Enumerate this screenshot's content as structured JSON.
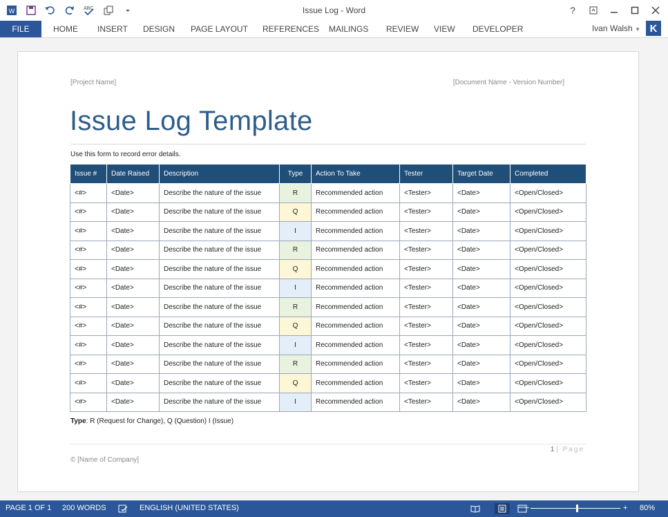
{
  "window": {
    "title": "Issue Log - Word",
    "help": "?",
    "user_name": "Ivan Walsh",
    "user_initial": "K"
  },
  "ribbon": {
    "file": "FILE",
    "tabs": [
      "HOME",
      "INSERT",
      "DESIGN",
      "PAGE LAYOUT",
      "REFERENCES",
      "MAILINGS",
      "REVIEW",
      "VIEW",
      "DEVELOPER"
    ]
  },
  "document": {
    "header_left": "[Project Name]",
    "header_right": "[Document Name - Version Number]",
    "title": "Issue Log Template",
    "intro": "Use this form to record error details.",
    "table": {
      "columns": [
        "Issue #",
        "Date Raised",
        "Description",
        "Type",
        "Action To Take",
        "Tester",
        "Target Date",
        "Completed"
      ],
      "rows": [
        [
          "<#>",
          "<Date>",
          "Describe the nature of the issue",
          "R",
          "Recommended action",
          "<Tester>",
          "<Date>",
          "<Open/Closed>"
        ],
        [
          "<#>",
          "<Date>",
          "Describe the nature of the issue",
          "Q",
          "Recommended action",
          "<Tester>",
          "<Date>",
          "<Open/Closed>"
        ],
        [
          "<#>",
          "<Date>",
          "Describe the nature of the issue",
          "I",
          "Recommended action",
          "<Tester>",
          "<Date>",
          "<Open/Closed>"
        ],
        [
          "<#>",
          "<Date>",
          "Describe the nature of the issue",
          "R",
          "Recommended action",
          "<Tester>",
          "<Date>",
          "<Open/Closed>"
        ],
        [
          "<#>",
          "<Date>",
          "Describe the nature of the issue",
          "Q",
          "Recommended action",
          "<Tester>",
          "<Date>",
          "<Open/Closed>"
        ],
        [
          "<#>",
          "<Date>",
          "Describe the nature of the issue",
          "I",
          "Recommended action",
          "<Tester>",
          "<Date>",
          "<Open/Closed>"
        ],
        [
          "<#>",
          "<Date>",
          "Describe the nature of the issue",
          "R",
          "Recommended action",
          "<Tester>",
          "<Date>",
          "<Open/Closed>"
        ],
        [
          "<#>",
          "<Date>",
          "Describe the nature of the issue",
          "Q",
          "Recommended action",
          "<Tester>",
          "<Date>",
          "<Open/Closed>"
        ],
        [
          "<#>",
          "<Date>",
          "Describe the nature of the issue",
          "I",
          "Recommended action",
          "<Tester>",
          "<Date>",
          "<Open/Closed>"
        ],
        [
          "<#>",
          "<Date>",
          "Describe the nature of the issue",
          "R",
          "Recommended action",
          "<Tester>",
          "<Date>",
          "<Open/Closed>"
        ],
        [
          "<#>",
          "<Date>",
          "Describe the nature of the issue",
          "Q",
          "Recommended action",
          "<Tester>",
          "<Date>",
          "<Open/Closed>"
        ],
        [
          "<#>",
          "<Date>",
          "Describe the nature of the issue",
          "I",
          "Recommended action",
          "<Tester>",
          "<Date>",
          "<Open/Closed>"
        ]
      ]
    },
    "legend_label": "Type",
    "legend_text": ": R (Request for Change), Q (Question) I (Issue)",
    "page_number": "1",
    "page_word": "| Page",
    "company": "© [Name of Company]"
  },
  "statusbar": {
    "page": "PAGE 1 OF 1",
    "words": "200 WORDS",
    "language": "ENGLISH (UNITED STATES)",
    "zoom_out": "−",
    "zoom_in": "+",
    "zoom": "80%"
  },
  "colors": {
    "accent": "#2b579a",
    "table_header": "#1f4e79",
    "title": "#2e5d8a",
    "type_R": "#e9f2df",
    "type_Q": "#fdf7d7",
    "type_I": "#e3eef9"
  },
  "icons": {
    "qat": [
      "word-logo-icon",
      "save-icon",
      "undo-icon",
      "redo-icon",
      "spelling-icon",
      "format-icon",
      "customize-icon"
    ],
    "window": [
      "help-icon",
      "ribbon-display-icon",
      "minimize-icon",
      "maximize-icon",
      "close-icon"
    ]
  }
}
